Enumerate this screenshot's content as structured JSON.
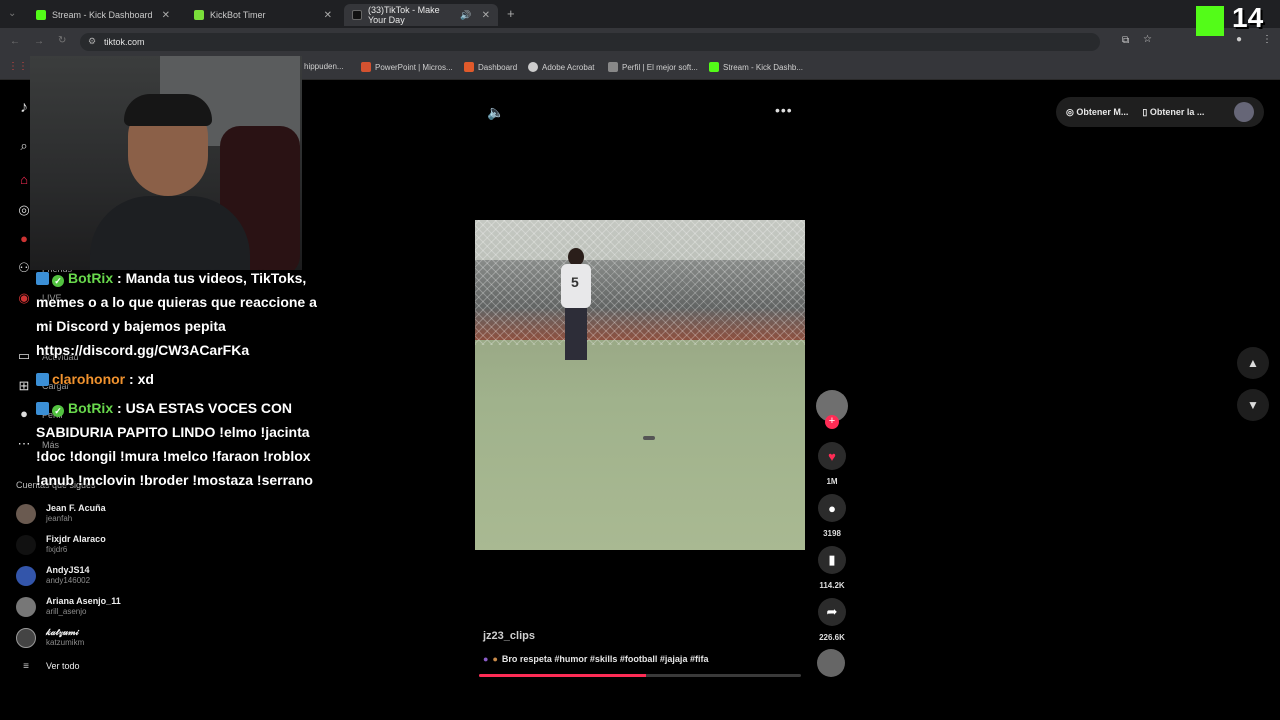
{
  "browser": {
    "tabs": [
      {
        "title": "Stream - Kick Dashboard",
        "favicon_color": "#53fc18",
        "active": false
      },
      {
        "title": "KickBot Timer",
        "favicon_color": "#7adf3a",
        "active": false
      },
      {
        "title": "(33)TikTok - Make Your Day",
        "favicon_color": "#000000",
        "active": true
      }
    ],
    "url": "tiktok.com",
    "bookmarks": [
      {
        "label": "hippuden...",
        "icon_color": "#aaaaaa"
      },
      {
        "label": "PowerPoint | Micros...",
        "icon_color": "#d35230"
      },
      {
        "label": "Dashboard",
        "icon_color": "#e05a2b"
      },
      {
        "label": "Adobe Acrobat",
        "icon_color": "#cccccc"
      },
      {
        "label": "Perfil | El mejor soft...",
        "icon_color": "#888888"
      },
      {
        "label": "Stream - Kick Dashb...",
        "icon_color": "#53fc18"
      }
    ]
  },
  "kick_overlay": {
    "count": "14",
    "logo_color": "#53fc18"
  },
  "sidebar": {
    "items": [
      {
        "icon": "search-icon",
        "label": ""
      },
      {
        "icon": "home-icon",
        "label": ""
      },
      {
        "icon": "explore-icon",
        "label": ""
      },
      {
        "icon": "following-icon",
        "label": ""
      },
      {
        "icon": "friends-icon",
        "label": "Friends"
      },
      {
        "icon": "live-icon",
        "label": "LIVE"
      },
      {
        "icon": "messages-icon",
        "label": "Actividad"
      },
      {
        "icon": "upload-icon",
        "label": "Cargar"
      },
      {
        "icon": "profile-icon",
        "label": "Perfil"
      },
      {
        "icon": "more-icon",
        "label": "Más"
      }
    ],
    "following_title": "Cuentas que sigues",
    "following": [
      {
        "name": "Jean F. Acuña",
        "handle": "jeanfah"
      },
      {
        "name": "Fixjdr Alaraco",
        "handle": "fixjdr6"
      },
      {
        "name": "AndyJS14",
        "handle": "andy146002"
      },
      {
        "name": "Ariana Asenjo_11",
        "handle": "arill_asenjo"
      },
      {
        "name": "𝓀𝒶𝓉𝓏𝓊𝓂𝒾",
        "handle": "katzumikm"
      }
    ],
    "see_all": "Ver todo"
  },
  "chat": [
    {
      "user": "BotRix",
      "verified": true,
      "message": ": Manda tus videos, TikToks, memes o a lo que quieras que reaccione a mi Discord y bajemos pepita https://discord.gg/CW3ACarFKa",
      "color": "#68d84c"
    },
    {
      "user": "clarohonor",
      "verified": false,
      "message": ": xd",
      "color": "#f0922e"
    },
    {
      "user": "BotRix",
      "verified": true,
      "message": ": USA ESTAS VOCES CON SABIDURIA PAPITO LINDO !elmo !jacinta !doc !dongil !mura !melco !faraon !roblox !anub !mclovin !broder !mostaza !serrano",
      "color": "#68d84c"
    }
  ],
  "header": {
    "buttons": [
      "Obtener M...",
      "Obtener la ..."
    ]
  },
  "video": {
    "jersey_number": "5",
    "username": "jz23_clips",
    "caption": "Bro respeta #humor #skills #football #jajaja #fifa",
    "progress": 0.52
  },
  "actions": {
    "likes": "1M",
    "comments": "3198",
    "saves": "114.2K",
    "shares": "226.6K"
  },
  "colors": {
    "accent": "#fe2c55",
    "kick_green": "#53fc18"
  }
}
